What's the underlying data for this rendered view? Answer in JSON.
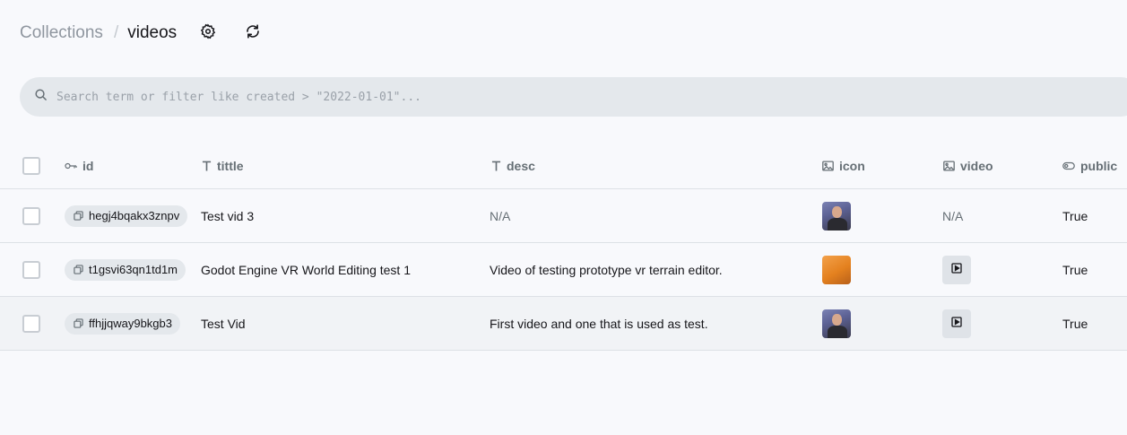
{
  "breadcrumb": {
    "root": "Collections",
    "separator": "/",
    "current": "videos"
  },
  "search": {
    "placeholder": "Search term or filter like created > \"2022-01-01\"..."
  },
  "table": {
    "columns": [
      {
        "key": "id",
        "label": "id",
        "icon": "key-icon"
      },
      {
        "key": "tittle",
        "label": "tittle",
        "icon": "text-type-icon"
      },
      {
        "key": "desc",
        "label": "desc",
        "icon": "text-type-icon"
      },
      {
        "key": "icon",
        "label": "icon",
        "icon": "image-icon"
      },
      {
        "key": "video",
        "label": "video",
        "icon": "image-icon"
      },
      {
        "key": "public",
        "label": "public",
        "icon": "toggle-icon"
      }
    ],
    "rows": [
      {
        "id": "hegj4bqakx3znpv",
        "tittle": "Test vid 3",
        "desc": "N/A",
        "icon": "person-thumbnail",
        "video": "N/A",
        "public": "True"
      },
      {
        "id": "t1gsvi63qn1td1m",
        "tittle": "Godot Engine VR World Editing test 1",
        "desc": "Video of testing prototype vr terrain editor.",
        "icon": "orange-thumbnail",
        "video": "video-file-icon",
        "public": "True"
      },
      {
        "id": "ffhjjqway9bkgb3",
        "tittle": "Test Vid",
        "desc": "First video and one that is used as test.",
        "icon": "person-thumbnail",
        "video": "video-file-icon",
        "public": "True"
      }
    ]
  }
}
